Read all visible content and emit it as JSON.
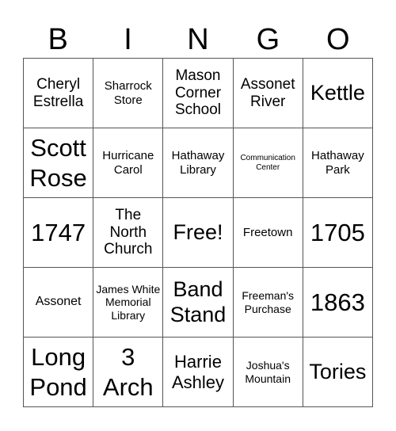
{
  "header": {
    "letters": [
      "B",
      "I",
      "N",
      "G",
      "O"
    ]
  },
  "cells": [
    {
      "text": "Cheryl Estrella",
      "size": "m"
    },
    {
      "text": "Sharrock Store",
      "size": "sm"
    },
    {
      "text": "Mason Corner School",
      "size": "m"
    },
    {
      "text": "Assonet River",
      "size": "m"
    },
    {
      "text": "Kettle",
      "size": "l"
    },
    {
      "text": "Scott Rose",
      "size": "xl"
    },
    {
      "text": "Hurricane Carol",
      "size": "sm"
    },
    {
      "text": "Hathaway Library",
      "size": "sm"
    },
    {
      "text": "Communication Center",
      "size": "xs"
    },
    {
      "text": "Hathaway Park",
      "size": "sm"
    },
    {
      "text": "1747",
      "size": "xl"
    },
    {
      "text": "The North Church",
      "size": "m"
    },
    {
      "text": "Free!",
      "size": "l"
    },
    {
      "text": "Freetown",
      "size": "sm"
    },
    {
      "text": "1705",
      "size": "xl"
    },
    {
      "text": "Assonet",
      "size": "n"
    },
    {
      "text": "James White Memorial Library",
      "size": "s"
    },
    {
      "text": "Band Stand",
      "size": "l"
    },
    {
      "text": "Freeman's Purchase",
      "size": "s"
    },
    {
      "text": "1863",
      "size": "xl"
    },
    {
      "text": "Long Pond",
      "size": "xl"
    },
    {
      "text": "3 Arch",
      "size": "xl"
    },
    {
      "text": "Harrie Ashley",
      "size": "ml"
    },
    {
      "text": "Joshua's Mountain",
      "size": "s"
    },
    {
      "text": "Tories",
      "size": "l"
    }
  ]
}
